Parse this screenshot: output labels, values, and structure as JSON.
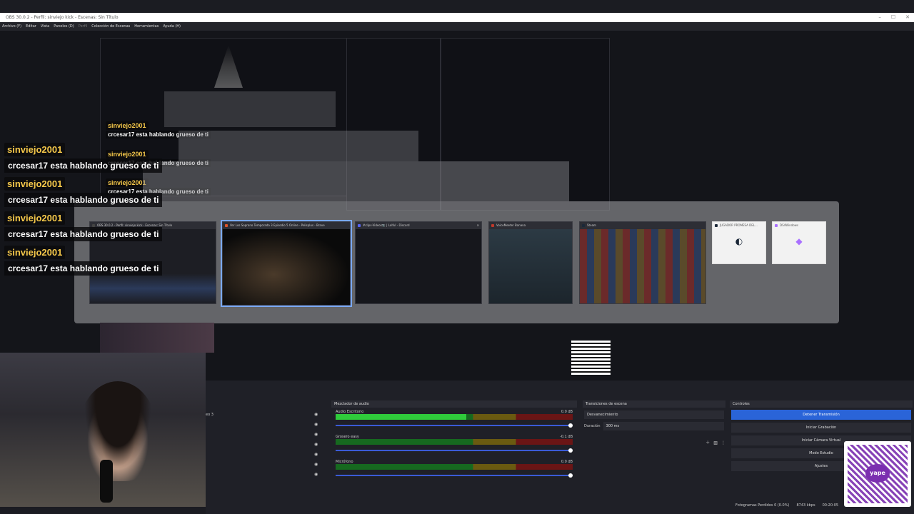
{
  "window": {
    "title": "OBS 30.0.2 - Perfil: sinviejo kick - Escenas: Sin Título",
    "controls": [
      "–",
      "☐",
      "✕"
    ]
  },
  "menu": [
    "Archivo (F)",
    "Editar",
    "Vista",
    "Paneles (D)",
    "Perfil",
    "Colección de Escenas",
    "Herramientas",
    "Ayuda (H)"
  ],
  "chat": [
    {
      "user": "sinviejo2001",
      "message": "crcesar17 esta hablando grueso de ti"
    },
    {
      "user": "sinviejo2001",
      "message": "crcesar17 esta hablando grueso de ti"
    },
    {
      "user": "sinviejo2001",
      "message": "crcesar17 esta hablando grueso de ti"
    },
    {
      "user": "sinviejo2001",
      "message": "crcesar17 esta hablando grueso de ti"
    }
  ],
  "chat_small": [
    {
      "user": "sinviejo2001",
      "message": "crcesar17 esta hablando grueso de ti"
    },
    {
      "user": "sinviejo2001",
      "message": "crcesar17 esta hablando grueso de ti"
    },
    {
      "user": "sinviejo2001",
      "message": "crcesar17 esta hablando grueso de ti"
    }
  ],
  "switcher": {
    "tiles": [
      {
        "title": "OBS 30.0.2 - Perfil: sinviejo kick - Escenas: Sin Título",
        "icon_color": "#3a3a3a"
      },
      {
        "title": "Ver Los Soprano Temporada 3 Episodio 5 Online - Pelisplus - Brave",
        "icon_color": "#e0552a"
      },
      {
        "title": "#clips-Videos📷 | Lolful - Discord",
        "icon_color": "#5865f2",
        "close": "✕"
      },
      {
        "title": "VoiceMeeter Banana",
        "icon_color": "#c0392b"
      },
      {
        "title": "Steam",
        "icon_color": "#1b2838"
      },
      {
        "title": "JUGADOR PROMESA DEL...",
        "icon_color": "#1b2838"
      },
      {
        "title": "DS4Windows",
        "icon_color": "#a970ff"
      }
    ]
  },
  "audio_mixer": {
    "title": "Mezclador de audio",
    "channels": [
      {
        "name": "Audio Escritorio",
        "db": "0.0 dB",
        "level": 0.55
      },
      {
        "name": "Grosero easy",
        "db": "-0.1 dB",
        "level": 0.0
      },
      {
        "name": "Micrófono",
        "db": "0.0 dB",
        "level": 0.0
      }
    ],
    "ticks": [
      "-60",
      "-55",
      "-50",
      "-45",
      "-40",
      "-35",
      "-30",
      "-25",
      "-20",
      "-15",
      "-10",
      "-5",
      "0"
    ]
  },
  "transitions": {
    "title": "Transiciones de escena",
    "selected": "Desvanecimiento",
    "duration_label": "Duración",
    "duration_value": "300 ms"
  },
  "controls": {
    "title": "Controles",
    "buttons": [
      "Detener Transmisión",
      "Iniciar Grabación",
      "Iniciar Cámara Virtual",
      "Modo Estudio",
      "Ajustes"
    ]
  },
  "sources": {
    "partial_label": "eo 3"
  },
  "status": {
    "dropped": "Fotogramas Perdidos 0 (0.0%)",
    "bitrate": "8743 kbps",
    "time": "00:20:05"
  },
  "qr_caption": "yape"
}
